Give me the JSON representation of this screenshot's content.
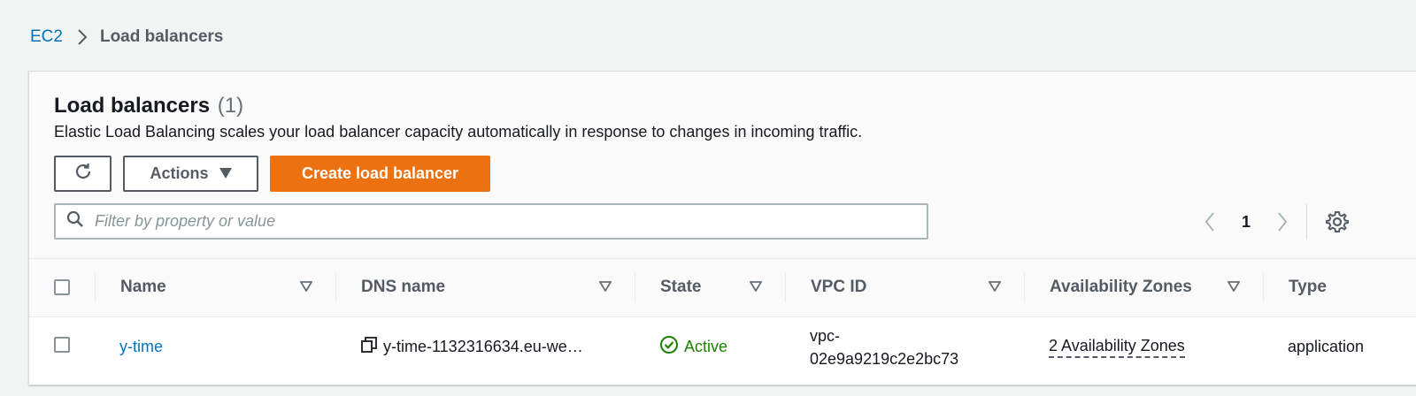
{
  "breadcrumb": {
    "root": "EC2",
    "current": "Load balancers"
  },
  "header": {
    "title": "Load balancers",
    "count": "(1)",
    "description": "Elastic Load Balancing scales your load balancer capacity automatically in response to changes in incoming traffic."
  },
  "toolbar": {
    "refresh_icon": "refresh-icon",
    "actions_label": "Actions",
    "create_label": "Create load balancer"
  },
  "filter": {
    "placeholder": "Filter by property or value",
    "value": ""
  },
  "pagination": {
    "current_page": "1"
  },
  "table": {
    "columns": [
      "Name",
      "DNS name",
      "State",
      "VPC ID",
      "Availability Zones",
      "Type"
    ],
    "rows": [
      {
        "name": "y-time",
        "dns_name": "y-time-1132316634.eu-we…",
        "state": "Active",
        "vpc_id_line1": "vpc-",
        "vpc_id_line2": "02e9a9219c2e2bc73",
        "availability_zones": "2 Availability Zones",
        "type": "application"
      }
    ]
  },
  "colors": {
    "accent_orange": "#ec7211",
    "link_blue": "#0073bb",
    "status_green": "#1d8102"
  }
}
